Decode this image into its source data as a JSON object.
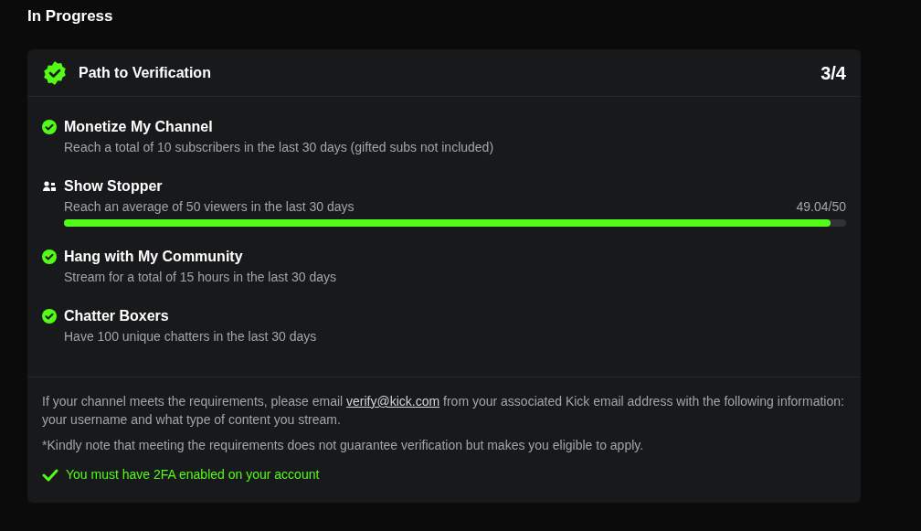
{
  "section_title": "In Progress",
  "card": {
    "title": "Path to Verification",
    "count": "3/4"
  },
  "requirements": [
    {
      "kind": "done",
      "title": "Monetize My Channel",
      "description": "Reach a total of 10 subscribers in the last 30 days (gifted subs not included)"
    },
    {
      "kind": "progress",
      "title": "Show Stopper",
      "description": "Reach an average of 50 viewers in the last 30 days",
      "reading": "49.04/50",
      "level": 0.98
    },
    {
      "kind": "done",
      "title": "Hang with My Community",
      "description": "Stream for a total of 15 hours in the last 30 days"
    },
    {
      "kind": "done",
      "title": "Chatter Boxers",
      "description": "Have 100 unique chatters in the last 30 days"
    }
  ],
  "footer": {
    "text_before": "If your channel meets the requirements, please email",
    "link": "verify@kick.com",
    "text_after": "from your associated Kick email address with the following information: your username and what type of content you stream.",
    "note": "*Kindly note that meeting the requirements does not guarantee verification but makes you eligible to apply.",
    "twofa": "You must have 2FA enabled on your account"
  }
}
